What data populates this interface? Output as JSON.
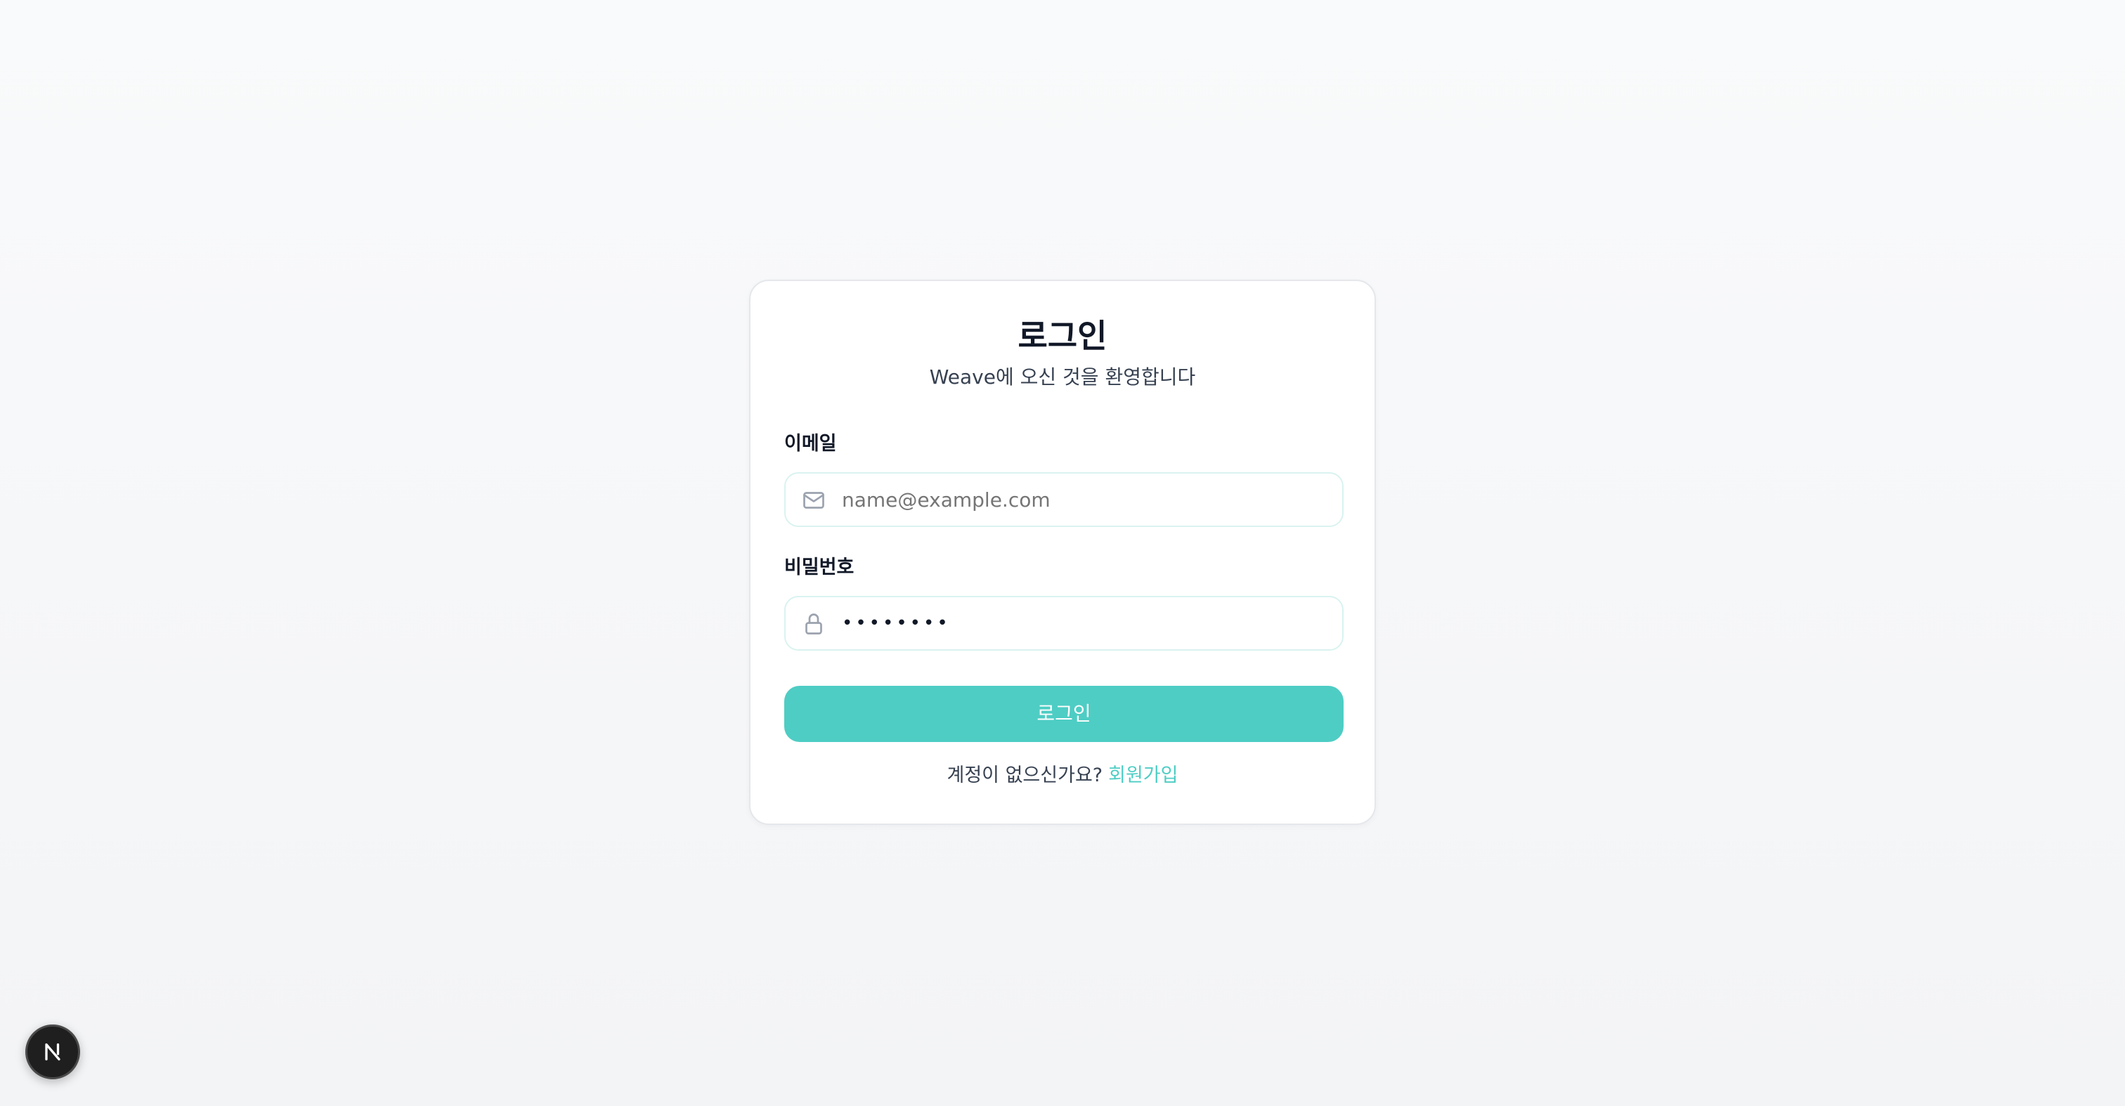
{
  "login": {
    "title": "로그인",
    "subtitle": "Weave에 오신 것을 환영합니다",
    "email_label": "이메일",
    "email_placeholder": "name@example.com",
    "password_label": "비밀번호",
    "password_value": "••••••••",
    "submit_label": "로그인",
    "signup_prompt": "계정이 없으신가요?",
    "signup_link": "회원가입"
  },
  "icons": {
    "email": "mail-icon",
    "password": "lock-icon",
    "badge": "nextjs-logo-icon"
  },
  "colors": {
    "accent": "#4ecdc4",
    "background": "#f9fafb",
    "card": "#ffffff",
    "field_border": "#d9f3f0",
    "badge": "#1f1f1f"
  }
}
